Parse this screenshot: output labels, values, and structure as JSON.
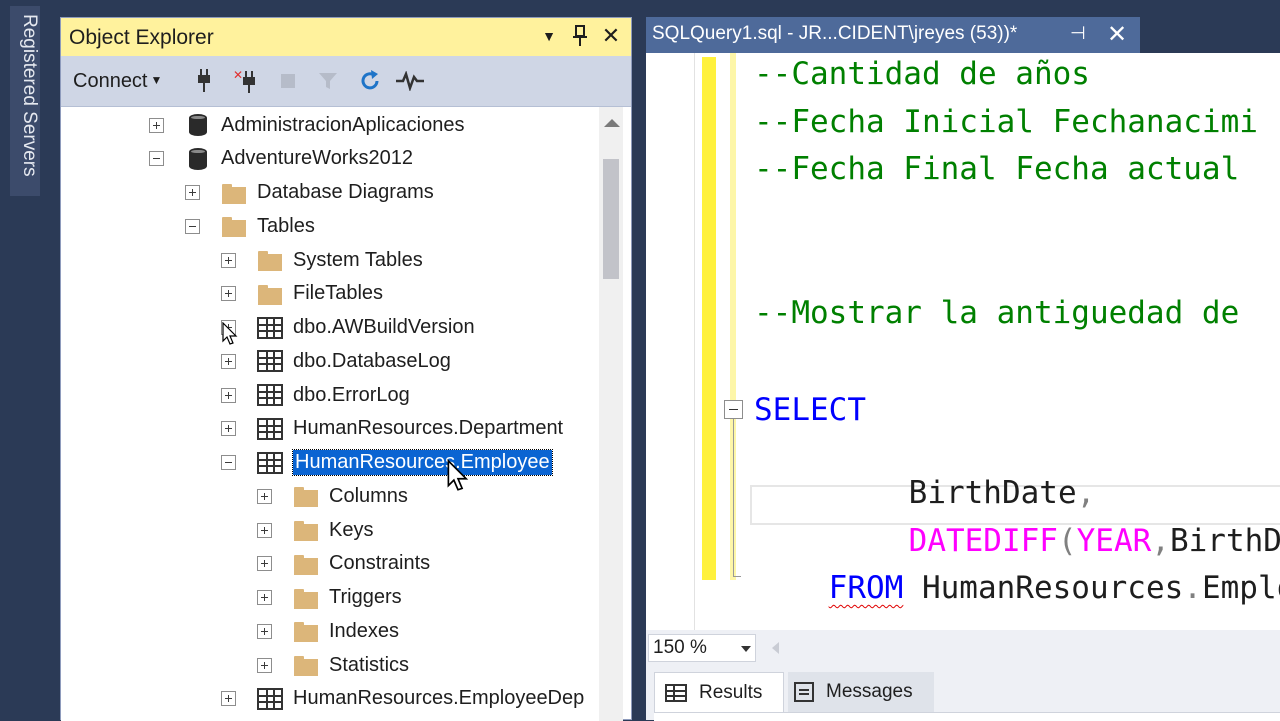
{
  "sidebar": {
    "registered_servers_label": "Registered Servers"
  },
  "object_explorer": {
    "title": "Object Explorer",
    "title_buttons": {
      "dropdown": "▼",
      "pin": "📌",
      "close": "✕"
    },
    "toolbar": {
      "connect_label": "Connect"
    },
    "tree": [
      {
        "label": "AdministracionAplicaciones",
        "icon": "database-icon",
        "expander": "plus"
      },
      {
        "label": "AdventureWorks2012",
        "icon": "database-icon",
        "expander": "minus"
      },
      {
        "label": "Database Diagrams",
        "icon": "folder-icon",
        "expander": "plus"
      },
      {
        "label": "Tables",
        "icon": "folder-icon",
        "expander": "minus"
      },
      {
        "label": "System Tables",
        "icon": "folder-icon",
        "expander": "plus"
      },
      {
        "label": "FileTables",
        "icon": "folder-icon",
        "expander": "plus"
      },
      {
        "label": "dbo.AWBuildVersion",
        "icon": "table-icon",
        "expander": "plus"
      },
      {
        "label": "dbo.DatabaseLog",
        "icon": "table-icon",
        "expander": "plus"
      },
      {
        "label": "dbo.ErrorLog",
        "icon": "table-icon",
        "expander": "plus"
      },
      {
        "label": "HumanResources.Department",
        "icon": "table-icon",
        "expander": "plus"
      },
      {
        "label": "HumanResources.Employee",
        "icon": "table-icon",
        "expander": "minus",
        "selected": true
      },
      {
        "label": "Columns",
        "icon": "folder-icon",
        "expander": "plus"
      },
      {
        "label": "Keys",
        "icon": "folder-icon",
        "expander": "plus"
      },
      {
        "label": "Constraints",
        "icon": "folder-icon",
        "expander": "plus"
      },
      {
        "label": "Triggers",
        "icon": "folder-icon",
        "expander": "plus"
      },
      {
        "label": "Indexes",
        "icon": "folder-icon",
        "expander": "plus"
      },
      {
        "label": "Statistics",
        "icon": "folder-icon",
        "expander": "plus"
      },
      {
        "label": "HumanResources.EmployeeDep",
        "icon": "table-icon",
        "expander": "plus"
      }
    ]
  },
  "editor": {
    "tab_title": "SQLQuery1.sql - JR...CIDENT\\jreyes (53))*",
    "tab_pin": "⊣",
    "tab_close": "✕",
    "code": {
      "line1": "--Cantidad de años",
      "line2": "--Fecha Inicial Fechanacimi",
      "line3": "--Fecha Final Fecha actual",
      "line4": "--Mostrar la antiguedad de",
      "select_kw": "SELECT",
      "birthdate": "BirthDate",
      "comma": ",",
      "datediff_fn": "DATEDIFF",
      "open_paren": "(",
      "year_kw": "YEAR",
      "birthdate2": "BirthDate",
      "from_kw": "FROM",
      "table_ref_schema": "HumanResources",
      "dot": ".",
      "table_ref_name": "Employe"
    },
    "zoom": "150 %"
  },
  "results_pane": {
    "tabs": [
      {
        "label": "Results"
      },
      {
        "label": "Messages"
      }
    ]
  },
  "colors": {
    "title_bar": "#fff29d",
    "selection": "#0a64d2",
    "comment": "#008000",
    "keyword": "#0000ff",
    "function": "#ff00ff"
  }
}
